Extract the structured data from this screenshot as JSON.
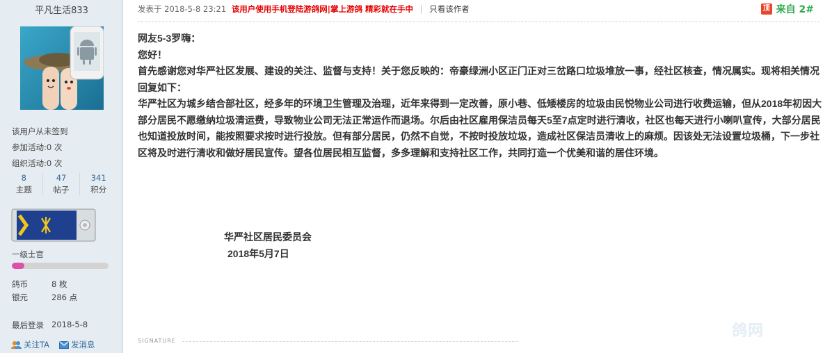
{
  "user": {
    "name": "平凡生活833",
    "sign_status": "该用户从未签到",
    "joined_activity": {
      "label": "参加活动:",
      "value": "0 次"
    },
    "organized_activity": {
      "label": "组织活动:",
      "value": "0 次"
    },
    "counts": [
      {
        "num": "8",
        "label": "主题"
      },
      {
        "num": "47",
        "label": "帖子"
      },
      {
        "num": "341",
        "label": "积分"
      }
    ],
    "rank": {
      "title": "一级士官",
      "progress_percent": 13
    },
    "currency": [
      {
        "label": "鸽币",
        "value": "8 枚"
      },
      {
        "label": "银元",
        "value": "286 点"
      }
    ],
    "last_login": {
      "label": "最后登录",
      "value": "2018-5-8"
    },
    "actions": {
      "follow": "关注TA",
      "message": "发消息"
    }
  },
  "post": {
    "meta": "发表于 2018-5-8 23:21",
    "ad_text": "该用户使用手机登陆游鸽网|掌上游鸽 精彩就在手中",
    "only_author": "只看该作者",
    "floor_icon": "顶",
    "floor_label": "来自 2#",
    "content": [
      "网友5-3罗嗨：",
      "您好！",
      "首先感谢您对华严社区发展、建设的关注、监督与支持！关于您反映的：帝豪绿洲小区正门正对三岔路口垃圾堆放一事，经社区核查，情况属实。现将相关情况回复如下：",
      "华严社区为城乡结合部社区，经多年的环境卫生管理及治理，近年来得到一定改善，原小巷、低矮楼房的垃圾由民悦物业公司进行收费运输，但从2018年初因大部分居民不愿缴纳垃圾清运费，导致物业公司无法正常运作而退场。尔后由社区雇用保洁员每天5至7点定时进行清收，社区也每天进行小喇叭宣传，大部分居民也知道投放时间，能按照要求按时进行投放。但有部分居民，仍然不自觉，不按时投放垃圾，造成社区保洁员清收上的麻烦。因该处无法设置垃圾桶，下一步社区将及时进行清收和做好居民宣传。望各位居民相互监督，多多理解和支持社区工作，共同打造一个优美和谐的居住环境。"
    ],
    "signature_org": "华严社区居民委员会",
    "signature_date": "2018年5月7日",
    "signature_label": "SIGNATURE"
  },
  "colors": {
    "sidebar_bg": "#e5edf2",
    "link": "#336699",
    "ad_red": "#e60000",
    "floor_green": "#2da94f",
    "rank_fill": "#e04ea7"
  }
}
